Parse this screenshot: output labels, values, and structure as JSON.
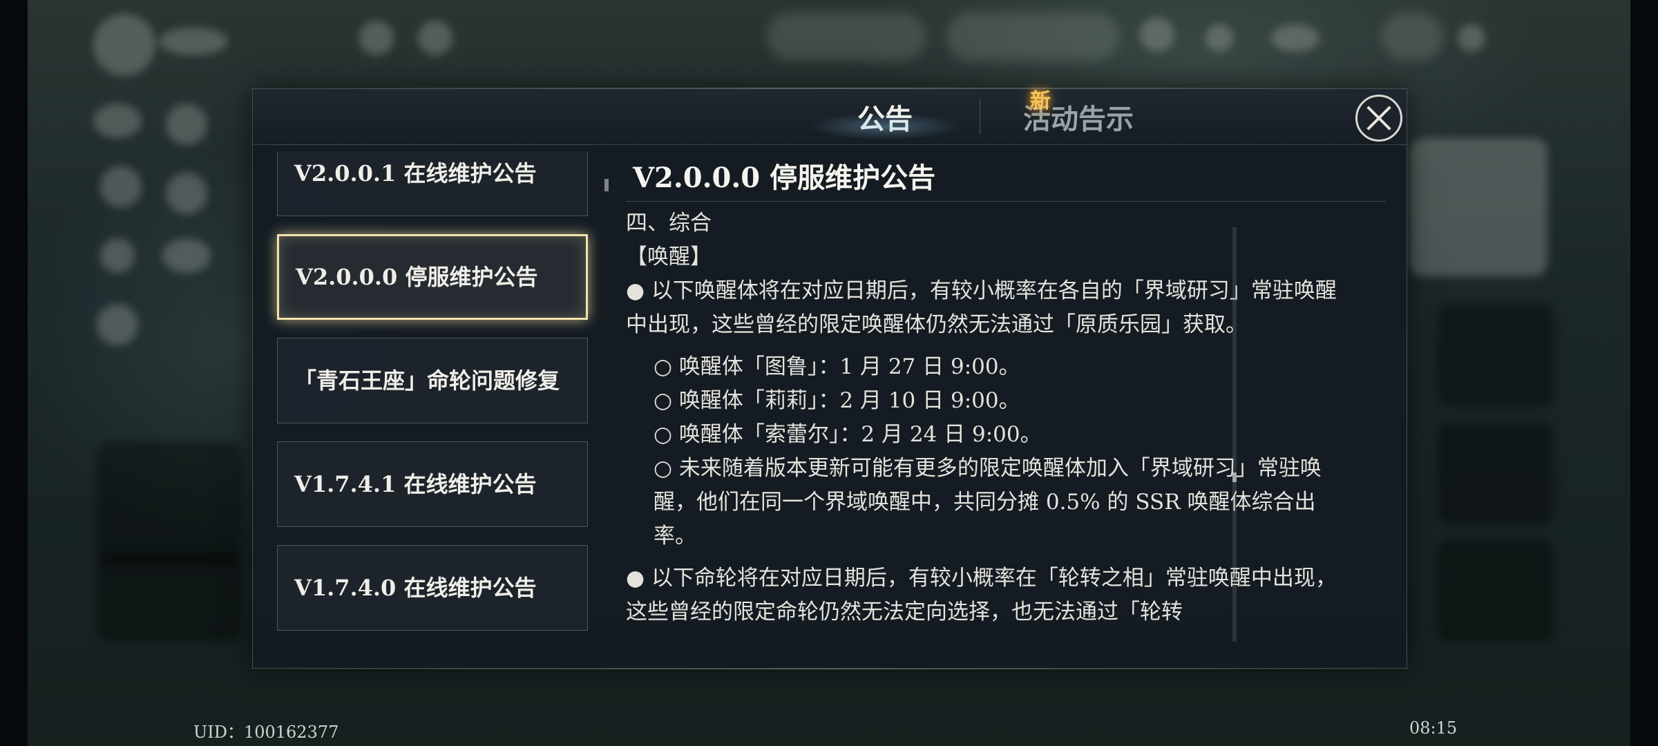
{
  "tabs": [
    {
      "label": "公告"
    },
    {
      "label": "活动告示"
    }
  ],
  "new_badge": "新",
  "announcement_list": [
    {
      "title": "V2.0.0.1 在线维护公告"
    },
    {
      "title": "V2.0.0.0 停服维护公告"
    },
    {
      "title": "「青石王座」命轮问题修复"
    },
    {
      "title": "V1.7.4.1 在线维护公告"
    },
    {
      "title": "V1.7.4.0 在线维护公告"
    }
  ],
  "content": {
    "title": "V2.0.0.0 停服维护公告",
    "lines": [
      "四、综合",
      "【唤醒】",
      "● 以下唤醒体将在对应日期后，有较小概率在各自的「界域研习」常驻唤醒中出现，这些曾经的限定唤醒体仍然无法通过「原质乐园」获取。",
      "○ 唤醒体「图鲁」：1 月 27 日 9:00。",
      "○ 唤醒体「莉莉」：2 月 10 日 9:00。",
      "○ 唤醒体「索蕾尔」：2 月 24 日 9:00。",
      "○ 未来随着版本更新可能有更多的限定唤醒体加入「界域研习」常驻唤醒，他们在同一个界域唤醒中，共同分摊 0.5% 的 SSR 唤醒体综合出率。",
      "● 以下命轮将在对应日期后，有较小概率在「轮转之相」常驻唤醒中出现，这些曾经的限定命轮仍然无法定向选择，也无法通过「轮转"
    ]
  },
  "footer": {
    "uid": "UID：100162377",
    "time": "08:15"
  }
}
